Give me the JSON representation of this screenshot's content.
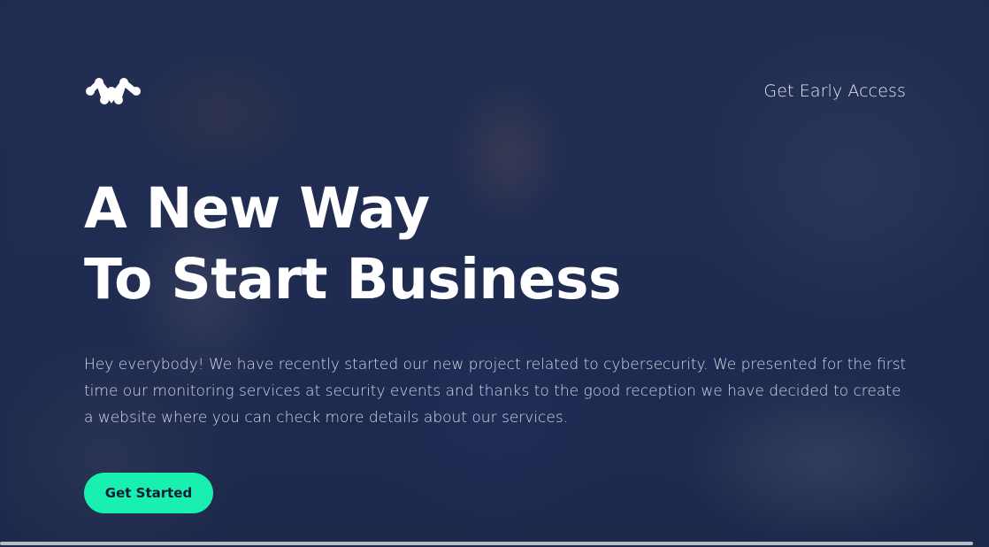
{
  "header": {
    "logo_icon": "brand-logo-icon",
    "nav_link_label": "Get Early Access"
  },
  "hero": {
    "title_line1": "A New Way",
    "title_line2": "To Start Business",
    "description": "Hey everybody! We have recently started our new project related to cybersecurity. We presented for the first time our monitoring services at security events and thanks to the good reception we have decided to create a website where you can check more details about our services.",
    "cta_label": "Get Started"
  },
  "colors": {
    "overlay": "#1b274a",
    "accent": "#19f0b0",
    "text_primary": "#ffffff",
    "text_secondary": "#d4d9e6"
  }
}
